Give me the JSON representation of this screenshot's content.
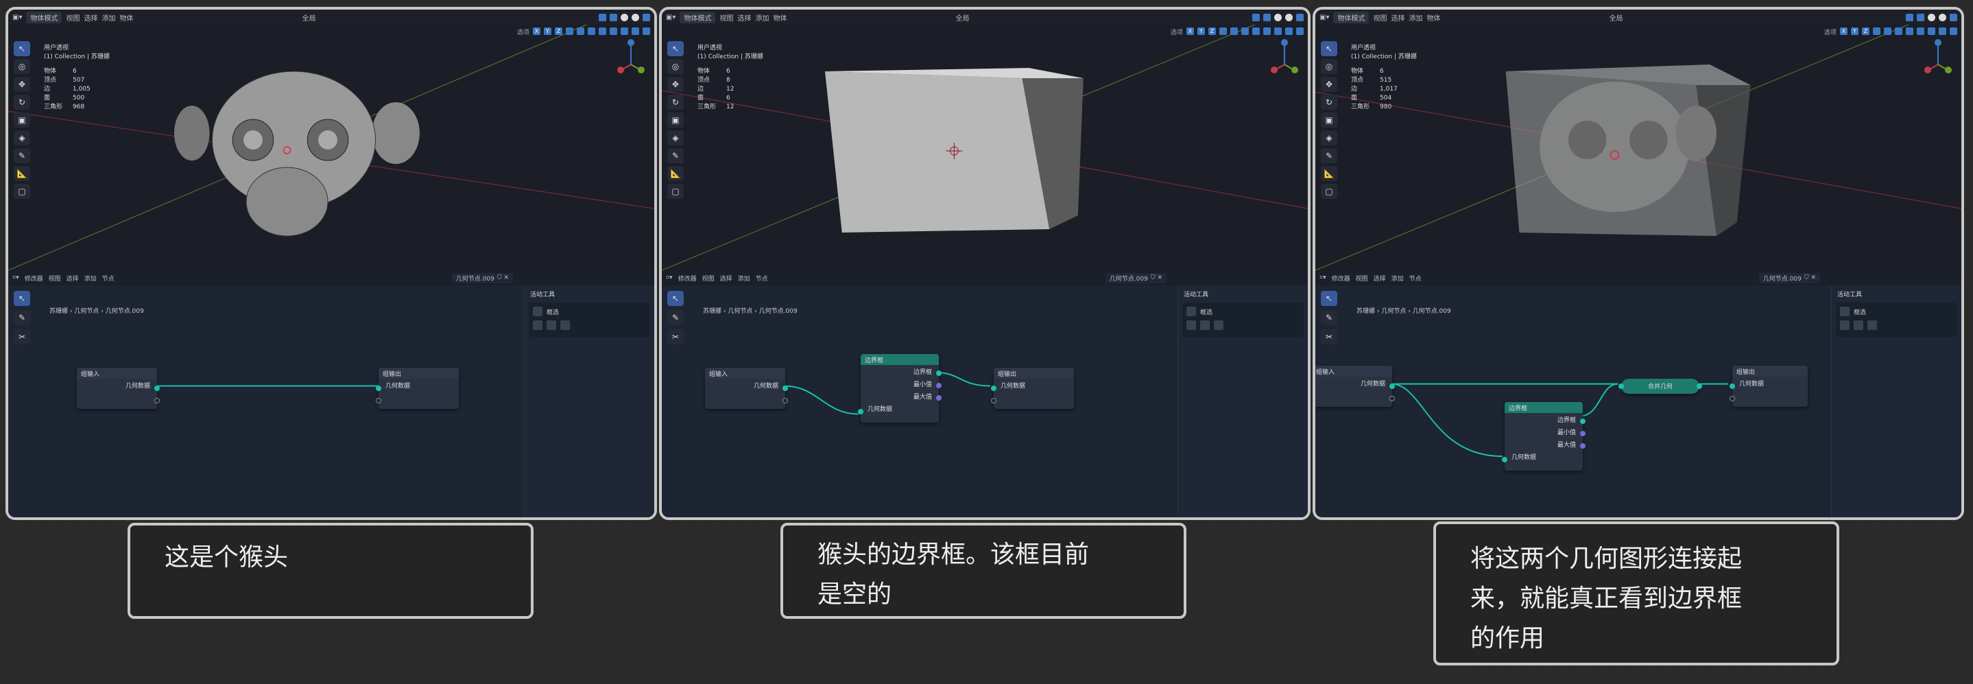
{
  "panels": [
    {
      "header": {
        "mode": "物体模式",
        "menus": [
          "视图",
          "选择",
          "添加",
          "物体"
        ],
        "global": "全局",
        "opts": "选项"
      },
      "overlay": {
        "view": "用户透视",
        "collection": "(1) Collection | 苏珊娜"
      },
      "stats": [
        {
          "label": "物体",
          "value": "6"
        },
        {
          "label": "顶点",
          "value": "507"
        },
        {
          "label": "边",
          "value": "1,005"
        },
        {
          "label": "面",
          "value": "500"
        },
        {
          "label": "三角形",
          "value": "968"
        }
      ],
      "editor": {
        "menu": [
          "修改器",
          "视图",
          "选择",
          "添加",
          "节点"
        ],
        "tree": "几何节点.009",
        "breadcrumb": [
          "苏珊娜",
          "几何节点",
          "几何节点.009"
        ],
        "side_title": "活动工具",
        "side_item": "框选",
        "nodes": {
          "input_title": "组输入",
          "input_socket": "几何数据",
          "output_title": "组输出",
          "output_socket": "几何数据"
        }
      }
    },
    {
      "header": {
        "mode": "物体模式",
        "menus": [
          "视图",
          "选择",
          "添加",
          "物体"
        ],
        "global": "全局",
        "opts": "选项"
      },
      "overlay": {
        "view": "用户透视",
        "collection": "(1) Collection | 苏珊娜"
      },
      "stats": [
        {
          "label": "物体",
          "value": "6"
        },
        {
          "label": "顶点",
          "value": "8"
        },
        {
          "label": "边",
          "value": "12"
        },
        {
          "label": "面",
          "value": "6"
        },
        {
          "label": "三角形",
          "value": "12"
        }
      ],
      "editor": {
        "menu": [
          "修改器",
          "视图",
          "选择",
          "添加",
          "节点"
        ],
        "tree": "几何节点.009",
        "breadcrumb": [
          "苏珊娜",
          "几何节点",
          "几何节点.009"
        ],
        "side_title": "活动工具",
        "side_item": "框选",
        "nodes": {
          "input_title": "组输入",
          "input_socket": "几何数据",
          "output_title": "组输出",
          "output_socket": "几何数据",
          "bbox_title": "边界框",
          "bbox_out": "边界框",
          "bbox_min": "最小值",
          "bbox_max": "最大值",
          "bbox_in": "几何数据"
        }
      }
    },
    {
      "header": {
        "mode": "物体模式",
        "menus": [
          "视图",
          "选择",
          "添加",
          "物体"
        ],
        "global": "全局",
        "opts": "选项"
      },
      "overlay": {
        "view": "用户透视",
        "collection": "(1) Collection | 苏珊娜"
      },
      "stats": [
        {
          "label": "物体",
          "value": "6"
        },
        {
          "label": "顶点",
          "value": "515"
        },
        {
          "label": "边",
          "value": "1,017"
        },
        {
          "label": "面",
          "value": "504"
        },
        {
          "label": "三角形",
          "value": "980"
        }
      ],
      "editor": {
        "menu": [
          "修改器",
          "视图",
          "选择",
          "添加",
          "节点"
        ],
        "tree": "几何节点.009",
        "breadcrumb": [
          "苏珊娜",
          "几何节点",
          "几何节点.009"
        ],
        "side_title": "活动工具",
        "side_item": "框选",
        "nodes": {
          "input_title": "组输入",
          "input_socket": "几何数据",
          "output_title": "组输出",
          "output_socket": "几何数据",
          "bbox_title": "边界框",
          "bbox_out": "边界框",
          "bbox_min": "最小值",
          "bbox_max": "最大值",
          "bbox_in": "几何数据",
          "join_title": "合并几何"
        }
      }
    }
  ],
  "captions": [
    {
      "line1": "这是个猴头",
      "line2": "",
      "line3": ""
    },
    {
      "line1": "猴头的边界框。该框目前",
      "line2": "是空的",
      "line3": ""
    },
    {
      "line1": "将这两个几何图形连接起",
      "line2": "来，就能真正看到边界框",
      "line3": "的作用"
    }
  ]
}
